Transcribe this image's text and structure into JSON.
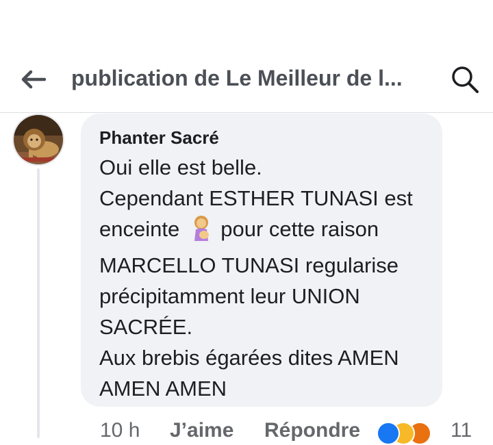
{
  "header": {
    "title": "publication de Le Meilleur de l..."
  },
  "comment": {
    "author": "Phanter Sacré",
    "lines": {
      "l1": "Oui elle est belle.",
      "l2": "Cependant ESTHER TUNASI est",
      "l3a": "enceinte",
      "l3b": "pour cette raison",
      "l4": "MARCELLO TUNASI regularise",
      "l5": "précipitamment leur UNION",
      "l6": "SACRÉE.",
      "l7": "Aux brebis égarées dites AMEN",
      "l8": "AMEN AMEN"
    },
    "actions": {
      "time": "10 h",
      "like": "J’aime",
      "reply": "Répondre",
      "reaction_count": "11"
    },
    "reactions": [
      "like",
      "haha",
      "angry"
    ],
    "emoji_in_text": "pregnant-woman-icon"
  },
  "colors": {
    "accent": "#1877f2",
    "bubble": "#f0f2f5",
    "secondary_text": "#65676b"
  }
}
